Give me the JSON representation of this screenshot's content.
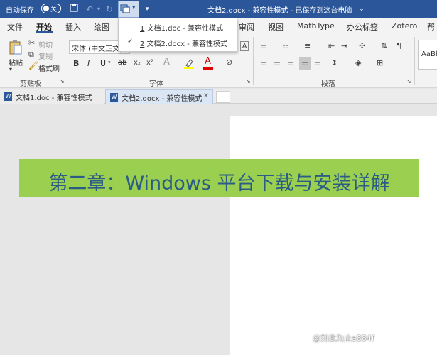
{
  "titlebar": {
    "autosave_label": "自动保存",
    "autosave_state": "关",
    "title": "文档2.docx  -  兼容性模式 - 已保存到这台电脑",
    "bg_color": "#2b579a"
  },
  "menu": {
    "tabs": [
      "文件",
      "开始",
      "插入",
      "绘图",
      "审阅",
      "视图",
      "MathType",
      "办公标签",
      "Zotero",
      "帮"
    ],
    "active_tab": "开始"
  },
  "ribbon": {
    "clipboard": {
      "paste_label": "粘贴",
      "cut_label": "剪切",
      "copy_label": "复制",
      "format_painter_label": "格式刷",
      "group_label": "剪贴板"
    },
    "font": {
      "font_name": "宋体 (中文正文)",
      "bold": "B",
      "italic": "I",
      "underline": "U",
      "strike": "ab",
      "font_color_glyph": "A",
      "group_label": "字体"
    },
    "paragraph": {
      "group_label": "段落"
    },
    "styles": {
      "sample": "AaBb"
    }
  },
  "switch_windows": {
    "items": [
      {
        "index": "1",
        "label": "文档1.doc  -  兼容性模式",
        "checked": false
      },
      {
        "index": "2",
        "label": "文档2.docx  -  兼容性模式",
        "checked": true
      }
    ]
  },
  "doc_tabs": [
    {
      "label": "文档1.doc  -  兼容性模式",
      "active": false
    },
    {
      "label": "文档2.docx  -  兼容性模式",
      "active": true
    }
  ],
  "banner": {
    "text": "第二章：Windows 平台下载与安装详解",
    "bg_color": "#9bcf4f",
    "text_color": "#2b5c86"
  },
  "watermark": "@刘此为止a884f"
}
